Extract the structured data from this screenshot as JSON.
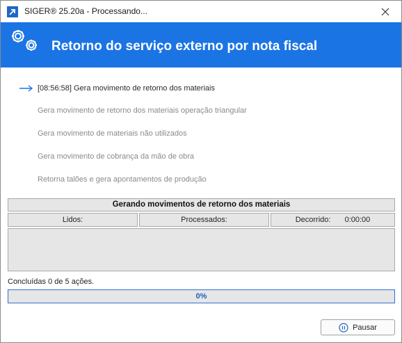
{
  "window": {
    "title": "SIGER® 25.20a - Processando..."
  },
  "header": {
    "title": "Retorno do serviço externo por nota fiscal",
    "icon": "gears-icon"
  },
  "steps": [
    {
      "label": "[08:56:58] Gera movimento de retorno dos materiais",
      "active": true
    },
    {
      "label": "Gera movimento de retorno dos materiais operação triangular",
      "active": false
    },
    {
      "label": "Gera movimento de materiais não utilizados",
      "active": false
    },
    {
      "label": "Gera movimento de cobrança da mão de obra",
      "active": false
    },
    {
      "label": "Retorna talões e gera apontamentos de produção",
      "active": false
    }
  ],
  "status": {
    "heading": "Gerando movimentos de retorno dos materiais",
    "lidos_label": "Lidos:",
    "processados_label": "Processados:",
    "decorrido_label": "Decorrido:",
    "decorrido_value": "0:00:00"
  },
  "summary": "Concluídas 0 de 5 ações.",
  "progress": {
    "value": 0,
    "text": "0%"
  },
  "buttons": {
    "pause_label": "Pausar"
  },
  "colors": {
    "accent": "#1b74e4",
    "header_text": "#ffffff"
  }
}
